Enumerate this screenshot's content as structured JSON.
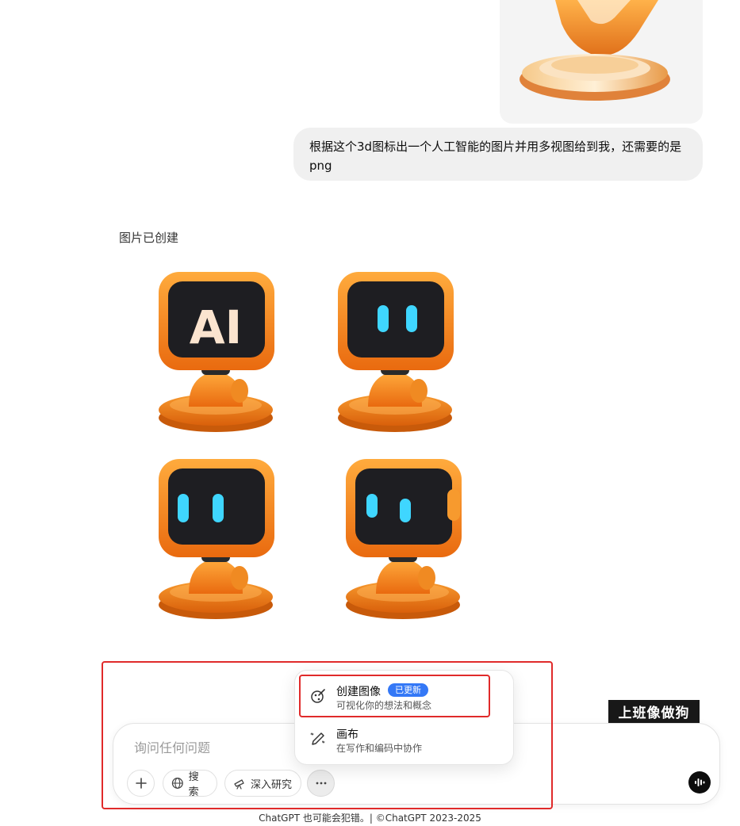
{
  "conversation": {
    "user_message": "根据这个3d图标出一个人工智能的图片并用多视图给到我，还需要的是png",
    "assistant_status": "图片已创建",
    "robot_screen_text": "AI"
  },
  "composer": {
    "placeholder": "询问任何问题",
    "tools": {
      "search_label": "搜索",
      "deep_research_label": "深入研究"
    }
  },
  "tools_menu": {
    "items": [
      {
        "title": "创建图像",
        "badge": "已更新",
        "description": "可视化你的想法和概念",
        "icon": "image-create-icon"
      },
      {
        "title": "画布",
        "description": "在写作和编码中协作",
        "icon": "canvas-pen-icon"
      }
    ]
  },
  "footer": {
    "text": "ChatGPT 也可能会犯错。| ©ChatGPT 2023-2025"
  },
  "watermark": {
    "text": "上班像做狗"
  },
  "colors": {
    "accent_orange": "#f28a1e",
    "badge_blue": "#3478f6",
    "annotation_red": "#e02a2a",
    "robot_eye": "#3fd6ff"
  }
}
